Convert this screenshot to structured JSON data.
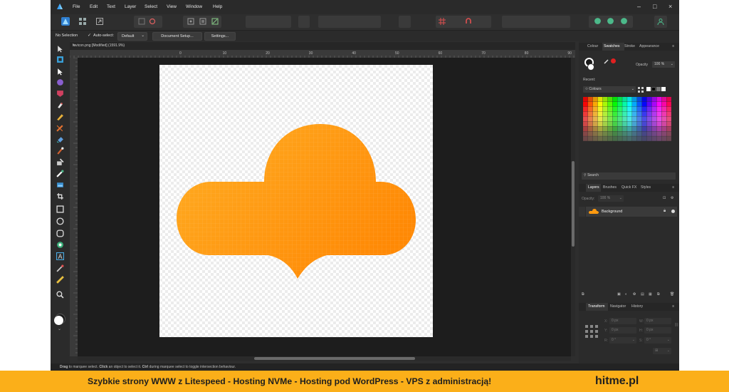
{
  "menubar": {
    "items": [
      {
        "label": "File"
      },
      {
        "label": "Edit"
      },
      {
        "label": "Text"
      },
      {
        "label": "Layer"
      },
      {
        "label": "Select"
      },
      {
        "label": "View"
      },
      {
        "label": "Window"
      },
      {
        "label": "Help"
      }
    ]
  },
  "contextbar": {
    "selection": "No Selection",
    "auto_select": "Auto-select:",
    "default_value": "Default",
    "document_setup": "Document Setup...",
    "settings": "Settings..."
  },
  "document": {
    "tab_title": "favicon.png [Modified] (1591.9%)",
    "ruler_labels": [
      "0",
      "10",
      "20",
      "30",
      "40",
      "50",
      "60",
      "70",
      "80",
      "90"
    ]
  },
  "colour_panel": {
    "tabs": [
      "Colour",
      "Swatches",
      "Stroke",
      "Appearance"
    ],
    "active_tab": "Swatches",
    "opacity_label": "Opacity",
    "opacity_value": "100 %",
    "recent_label": "Recent:",
    "palette_name": "Colours",
    "search_placeholder": "Search"
  },
  "layers_panel": {
    "tabs": [
      "Layers",
      "Brushes",
      "Quick FX",
      "Styles"
    ],
    "active_tab": "Layers",
    "opacity_label": "Opacity:",
    "opacity_value": "100 %",
    "layer_name": "Background"
  },
  "transform_panel": {
    "tabs": [
      "Transform",
      "Navigator",
      "History"
    ],
    "active_tab": "Transform",
    "x_label": "X:",
    "x_value": "0 px",
    "w_label": "W:",
    "w_value": "0 px",
    "y_label": "Y:",
    "y_value": "0 px",
    "h_label": "H:",
    "h_value": "0 px",
    "r_label": "R:",
    "r_value": "0 °",
    "s_label": "S:",
    "s_value": "0 °"
  },
  "statusbar": {
    "drag": "Drag",
    "t1": " to marquee select. ",
    "click": "Click",
    "t2": " an object to select it. ",
    "ctrl": "Ctrl",
    "t3": " during marquee select to toggle intersection behaviour."
  },
  "banner": {
    "text": "Szybkie strony WWW z Litespeed - Hosting  NVMe - Hosting pod WordPress - VPS z administracją!",
    "brand": "hitme.pl"
  },
  "colors": {
    "cloud_light": "#ffaa1e",
    "cloud_dark": "#ff8a05",
    "banner": "#fbaf19",
    "app_bg": "#2e2e2e"
  }
}
